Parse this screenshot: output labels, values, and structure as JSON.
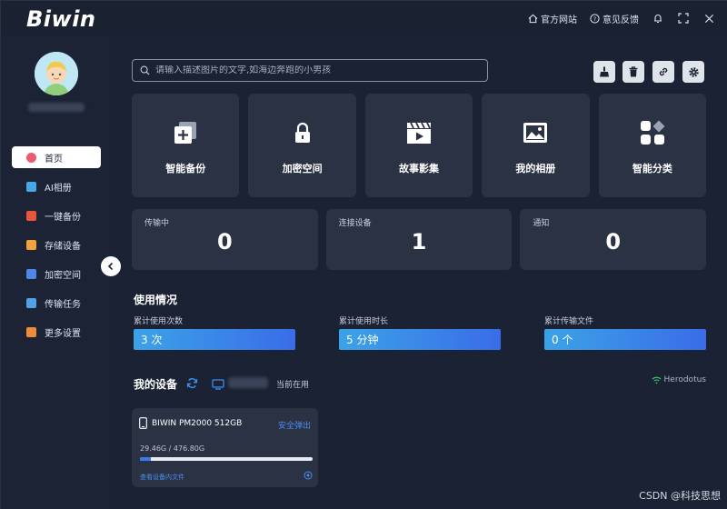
{
  "app": {
    "logo_text": "Biwin"
  },
  "topbar": {
    "official_site": "官方网站",
    "feedback": "意见反馈",
    "icons": [
      "home-icon",
      "help-circle-icon",
      "bell-icon",
      "fullscreen-icon",
      "close-icon"
    ]
  },
  "sidebar": {
    "items": [
      {
        "label": "首页",
        "icon": "home-dot-icon",
        "color": "#e85c6c",
        "active": true
      },
      {
        "label": "AI相册",
        "icon": "ai-album-icon",
        "color": "#47a7e8",
        "active": false
      },
      {
        "label": "一键备份",
        "icon": "backup-icon",
        "color": "#e8553e",
        "active": false
      },
      {
        "label": "存储设备",
        "icon": "storage-icon",
        "color": "#f0a23b",
        "active": false
      },
      {
        "label": "加密空间",
        "icon": "folder-lock-icon",
        "color": "#4f86e8",
        "active": false
      },
      {
        "label": "传输任务",
        "icon": "transfer-icon",
        "color": "#4fa2e8",
        "active": false
      },
      {
        "label": "更多设置",
        "icon": "settings-icon",
        "color": "#f08a3b",
        "active": false
      }
    ]
  },
  "search": {
    "placeholder": "请输入描述图片的文字,如海边奔跑的小男孩"
  },
  "tiles": [
    {
      "label": "智能备份",
      "icon": "smart-backup-icon"
    },
    {
      "label": "加密空间",
      "icon": "lock-icon"
    },
    {
      "label": "故事影集",
      "icon": "clapperboard-icon"
    },
    {
      "label": "我的相册",
      "icon": "image-icon"
    },
    {
      "label": "智能分类",
      "icon": "category-icon"
    }
  ],
  "stats": [
    {
      "label": "传输中",
      "value": "0"
    },
    {
      "label": "连接设备",
      "value": "1"
    },
    {
      "label": "通知",
      "value": "0"
    }
  ],
  "usage": {
    "title": "使用情况",
    "items": [
      {
        "label": "累计使用次数",
        "value": "3 次"
      },
      {
        "label": "累计使用时长",
        "value": "5 分钟"
      },
      {
        "label": "累计传输文件",
        "value": "0 个"
      }
    ]
  },
  "devices": {
    "title": "我的设备",
    "current_use": "当前在用",
    "brand": "Herodotus",
    "card": {
      "name": "BIWIN PM2000 512GB",
      "eject": "安全弹出",
      "size": "29.46G / 476.80G",
      "used_fraction": 0.062,
      "view_files": "查看设备内文件"
    }
  },
  "watermark": "CSDN @科技思想",
  "colors": {
    "accent": "#3a7be8",
    "bg": "#1b2233",
    "card": "#2a3244"
  }
}
